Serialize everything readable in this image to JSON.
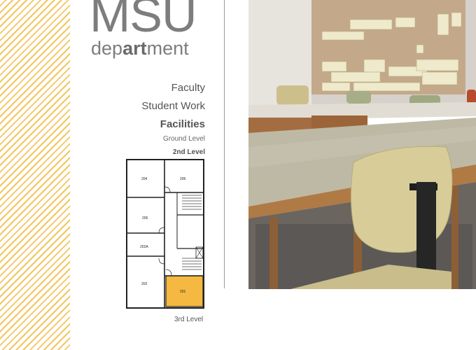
{
  "logo": {
    "msu": "MSU",
    "dept_pre": "dep",
    "dept_bold": "art",
    "dept_post": "ment"
  },
  "nav": {
    "faculty": "Faculty",
    "student_work": "Student Work",
    "facilities": "Facilities",
    "ground_level": "Ground Level",
    "second_level": "2nd Level",
    "third_level": "3rd Level"
  },
  "floorplan": {
    "rooms": [
      "204",
      "206",
      "205",
      "202A",
      "202",
      "201"
    ],
    "highlighted_room": "201",
    "highlight_color": "#f5b841"
  },
  "colors": {
    "stripe": "#f3c660",
    "logo_gray": "#7d7d7d"
  }
}
